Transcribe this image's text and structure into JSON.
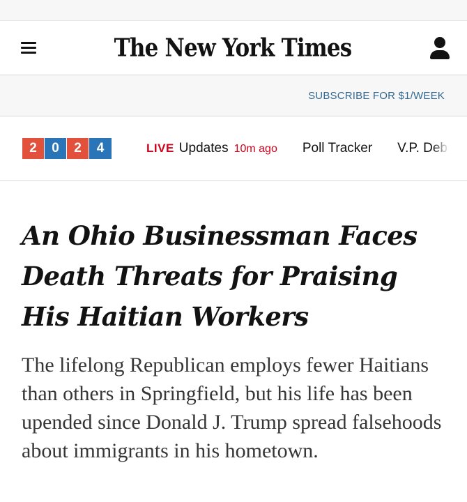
{
  "masthead": {
    "logo_text": "The New York Times",
    "menu_icon": "hamburger-menu-icon",
    "account_icon": "user-account-icon"
  },
  "subscribe": {
    "label": "SUBSCRIBE FOR $1/WEEK"
  },
  "nav": {
    "year_digits": [
      "2",
      "0",
      "2",
      "4"
    ],
    "year_colors": [
      "#e2513c",
      "#2a74b8",
      "#e2513c",
      "#2a74b8"
    ],
    "live_label": "LIVE",
    "live_text": "Updates",
    "live_time": "10m ago",
    "links": [
      "Poll Tracker",
      "V.P. Deb"
    ]
  },
  "article": {
    "headline": "An Ohio Businessman Faces Death Threats for Praising His Haitian Workers",
    "summary": "The lifelong Republican employs fewer Haitians than others in Springfield, but his life has been upended since Donald J. Trump spread falsehoods about immigrants in his hometown."
  },
  "colors": {
    "accent_link": "#326891",
    "live_red": "#d0021b"
  }
}
